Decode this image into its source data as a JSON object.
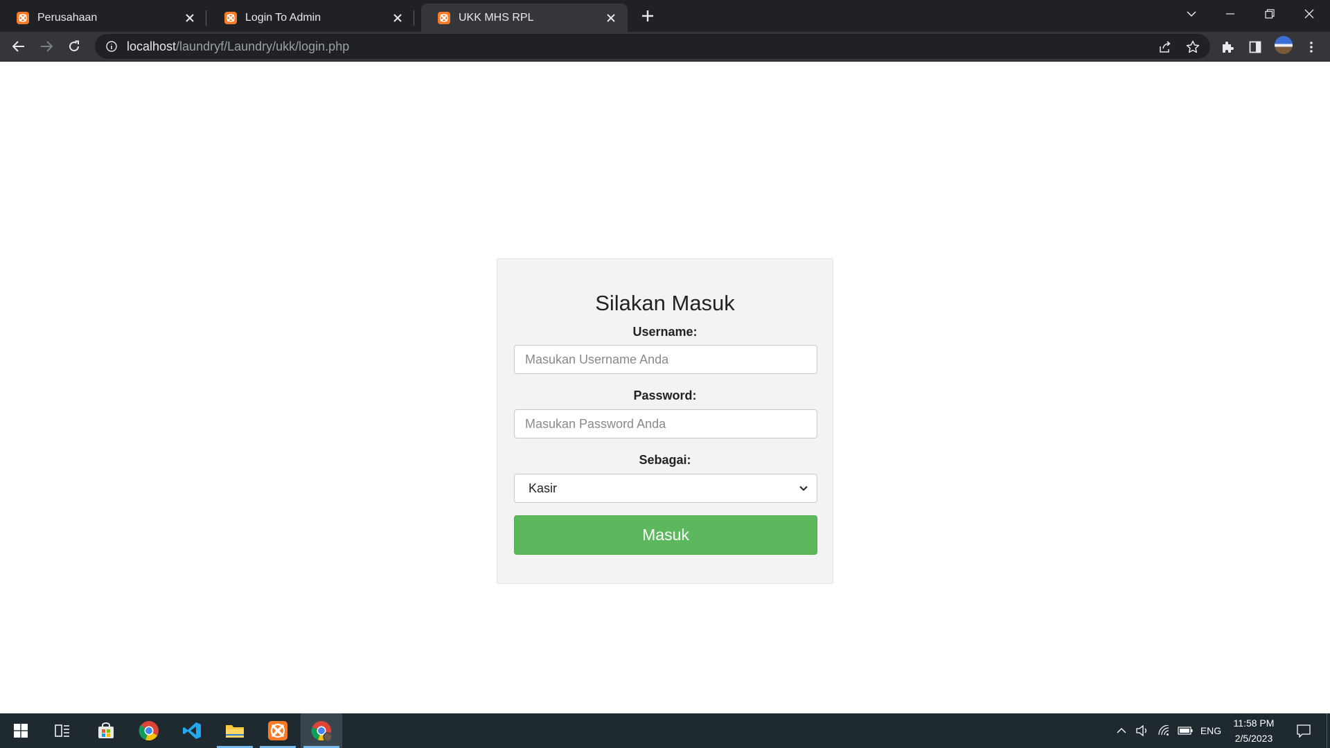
{
  "browser": {
    "tabs": [
      {
        "title": "Perusahaan",
        "active": false
      },
      {
        "title": "Login To Admin",
        "active": false
      },
      {
        "title": "UKK MHS RPL",
        "active": true
      }
    ],
    "url_host": "localhost",
    "url_path": "/laundryf/Laundry/ukk/login.php"
  },
  "login": {
    "heading": "Silakan Masuk",
    "username_label": "Username:",
    "username_placeholder": "Masukan Username Anda",
    "password_label": "Password:",
    "password_placeholder": "Masukan Password Anda",
    "role_label": "Sebagai:",
    "role_value": "Kasir",
    "submit_label": "Masuk"
  },
  "colors": {
    "submit_button": "#5cb85c",
    "favicon": "#fb7a24",
    "card_background": "#f3f3f3"
  },
  "taskbar": {
    "apps": [
      "start-icon",
      "task-view-icon",
      "store-icon",
      "chrome-icon",
      "vscode-icon",
      "file-explorer-icon",
      "xampp-icon",
      "chrome-profile-icon"
    ],
    "language": "ENG",
    "time": "11:58 PM",
    "date": "2/5/2023"
  }
}
